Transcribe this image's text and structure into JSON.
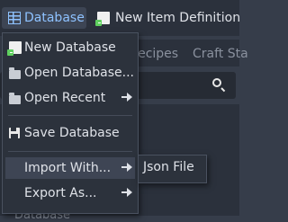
{
  "toolbar": {
    "database_label": "Database",
    "new_item_label": "New Item Definition"
  },
  "background_tabs": [
    "Recipes",
    "Craft Sta"
  ],
  "background_cut_text": "Database",
  "menu": {
    "items": [
      {
        "label": "New Database",
        "icon": "new-database-icon"
      },
      {
        "label": "Open Database...",
        "icon": "folder-open-icon"
      },
      {
        "label": "Open Recent",
        "icon": "folder-open-icon",
        "submenu": true
      },
      {
        "label": "Save Database",
        "icon": "save-icon"
      },
      {
        "label": "Import With...",
        "submenu": true,
        "highlighted": true
      },
      {
        "label": "Export As...",
        "submenu": true
      }
    ]
  },
  "submenu": {
    "items": [
      {
        "label": "Json File"
      }
    ]
  },
  "colors": {
    "accent": "#8ec2ff",
    "menu_bg": "#2c323c",
    "highlight": "#3e4554",
    "add_green": "#5fd05f"
  }
}
